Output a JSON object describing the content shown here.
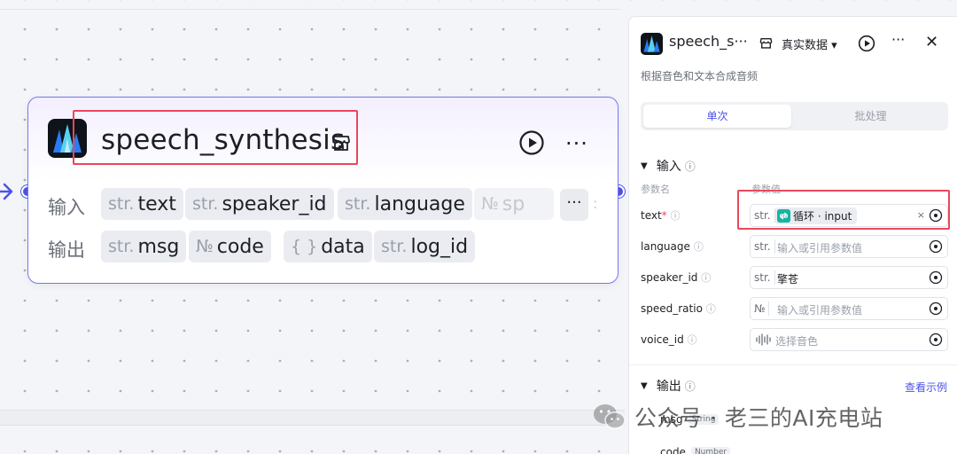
{
  "node": {
    "title": "speech_synthesis",
    "input_label": "输入",
    "output_label": "输出",
    "inputs": [
      {
        "type": "str.",
        "name": "text"
      },
      {
        "type": "str.",
        "name": "speaker_id"
      },
      {
        "type": "str.",
        "name": "language"
      },
      {
        "type": "№",
        "name": "sp"
      }
    ],
    "outputs": [
      {
        "type": "str.",
        "name": "msg"
      },
      {
        "type": "№",
        "name": "code"
      },
      {
        "type": "{ }",
        "name": "data"
      },
      {
        "type": "str.",
        "name": "log_id"
      }
    ],
    "more_label": "···",
    "overflow_mark": ":"
  },
  "panel": {
    "title": "speech_s···",
    "mode_label": "真实数据 ▾",
    "more_label": "···",
    "close_label": "✕",
    "description": "根据音色和文本合成音频",
    "tabs": [
      "单次",
      "批处理"
    ],
    "input_section": "输入",
    "col_param_name": "参数名",
    "col_param_value": "参数值",
    "params": [
      {
        "name": "text",
        "required": "*",
        "type": "str.",
        "value": "循环 · input",
        "clear": "×"
      },
      {
        "name": "language",
        "required": "",
        "type": "str.",
        "placeholder": "输入或引用参数值"
      },
      {
        "name": "speaker_id",
        "required": "",
        "type": "str.",
        "value": "擎苍"
      },
      {
        "name": "speed_ratio",
        "required": "",
        "type": "№",
        "placeholder": "输入或引用参数值"
      },
      {
        "name": "voice_id",
        "required": "",
        "type": "",
        "placeholder": "选择音色"
      }
    ],
    "output_section": "输出",
    "view_example": "查看示例",
    "outputs": [
      {
        "name": "msg",
        "type": "String"
      },
      {
        "name": "code",
        "type": "Number"
      }
    ],
    "info_glyph": "ⓘ"
  },
  "watermark": {
    "text": "公众号 · 老三的AI充电站"
  },
  "colors": {
    "accent": "#4d53e8",
    "highlight": "#e9485a",
    "loop_chip": "#18b3a5"
  }
}
